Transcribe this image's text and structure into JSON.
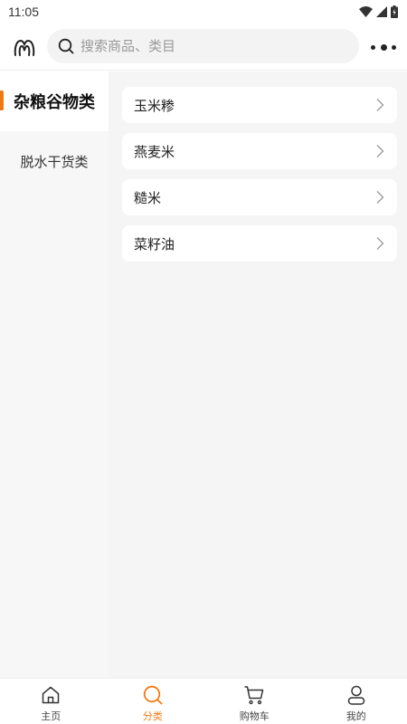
{
  "status_bar": {
    "time": "11:05",
    "icons": [
      "wifi-icon",
      "signal-icon",
      "battery-icon"
    ]
  },
  "header": {
    "logo_icon": "logo-icon",
    "search": {
      "placeholder": "搜索商品、类目",
      "value": ""
    },
    "more_icon": "more-icon"
  },
  "sidebar": {
    "items": [
      {
        "label": "杂粮谷物类",
        "active": true
      },
      {
        "label": "脱水干货类",
        "active": false
      }
    ]
  },
  "content": {
    "items": [
      {
        "label": "玉米糁"
      },
      {
        "label": "燕麦米"
      },
      {
        "label": "糙米"
      },
      {
        "label": "菜籽油"
      }
    ]
  },
  "tabbar": {
    "tabs": [
      {
        "label": "主页",
        "icon": "home-icon",
        "active": false
      },
      {
        "label": "分类",
        "icon": "category-search-icon",
        "active": true
      },
      {
        "label": "购物车",
        "icon": "cart-icon",
        "active": false
      },
      {
        "label": "我的",
        "icon": "user-icon",
        "active": false
      }
    ]
  },
  "colors": {
    "accent": "#f07a12",
    "sidebar_bg": "#f7f7f7",
    "content_bg": "#f5f5f5",
    "search_bg": "#f3f3f3"
  }
}
